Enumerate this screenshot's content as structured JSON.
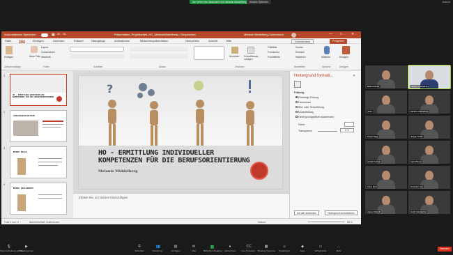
{
  "zoom": {
    "share_banner": "Sie sehen den Bildschirm von Melanie Middelberg",
    "view_options": "Ansicht Optionen",
    "top_right": "Ansicht",
    "toolbar": [
      {
        "icon": "microphone-icon",
        "label": "Stummschaltung aufheben"
      },
      {
        "icon": "camera-icon",
        "label": "Video beenden"
      },
      {
        "icon": "security-icon",
        "label": "Sicherheit"
      },
      {
        "icon": "participants-icon",
        "label": "Teilnehmer"
      },
      {
        "icon": "polls-icon",
        "label": "Umfragen"
      },
      {
        "icon": "chat-icon",
        "label": "Chat"
      },
      {
        "icon": "share-screen-icon",
        "label": "Bildschirm freigeben"
      },
      {
        "icon": "record-icon",
        "label": "Aufzeichnen"
      },
      {
        "icon": "transcript-icon",
        "label": "Live-Transkript"
      },
      {
        "icon": "breakout-icon",
        "label": "Breakout Sessions"
      },
      {
        "icon": "reactions-icon",
        "label": "Reaktionen"
      },
      {
        "icon": "apps-icon",
        "label": "Apps"
      },
      {
        "icon": "whiteboard-icon",
        "label": "Whiteboards"
      },
      {
        "icon": "more-icon",
        "label": "Mehr"
      }
    ],
    "end_button": "Beenden",
    "participants": [
      {
        "name": "Bettina Hofer"
      },
      {
        "name": "Melanie Middelberg"
      },
      {
        "name": "Josie"
      },
      {
        "name": "Melanie Middelberg"
      },
      {
        "name": "Kinga Nagy"
      },
      {
        "name": "Jürgen Nobis"
      },
      {
        "name": "Harald Jelinek"
      },
      {
        "name": "Ingrid Beyer"
      },
      {
        "name": "Anne Metz"
      },
      {
        "name": "Christian Lies"
      },
      {
        "name": "Agnes Meindl"
      },
      {
        "name": "Heidi Gaisbacher"
      }
    ]
  },
  "ppt": {
    "autosave": "Automatisches Speichern",
    "doc_title": "Präsentation_Projektarbeit_HO_MelanieMiddelberg • Gespeichert",
    "user": "Melanie Middelberg-Deltermann",
    "comments": "Kommentare",
    "share": "Freigeben",
    "tabs": [
      "Datei",
      "Start",
      "Einfügen",
      "Zeichnen",
      "Entwurf",
      "Übergänge",
      "Animationen",
      "Bildschirmpräsentation",
      "Überprüfen",
      "Ansicht",
      "Hilfe"
    ],
    "active_tab": "Start",
    "ribbon": {
      "paste": "Einfügen",
      "new_slide": "Neue Folie",
      "layout": "Layout",
      "reset": "Zurücksetzen",
      "section": "Abschnitt",
      "find": "Suchen",
      "replace": "Ersetzen",
      "select": "Markieren",
      "dictate": "Diktieren",
      "designer": "Designer",
      "arrange": "Anordnen",
      "quick_styles": "Schnellformat-vorlagen",
      "shape_fill": "Fülleffekt",
      "shape_outline": "Formkontur",
      "shape_effects": "Formeffekte",
      "groups": [
        "Zwischenablage",
        "Folien",
        "Schriftart",
        "Absatz",
        "Zeichnen",
        "Bearbeiten",
        "Sprache",
        "Designer"
      ]
    },
    "slides": [
      {
        "num": "1",
        "title": "HO - ERMITTLUNG INDIVIDUELLER KOMPETENZEN FÜR DIE BERUFSORIENTIERUNG"
      },
      {
        "num": "2",
        "title": "AUSGANGSSITUATION"
      },
      {
        "num": "3",
        "title": "MEINE ROLLE"
      },
      {
        "num": "4",
        "title": "MEINE ZIELGRUPPE"
      }
    ],
    "main_slide": {
      "title_line1": "HO - ERMITTLUNG INDIVIDUELLER",
      "title_line2": "KOMPETENZEN FÜR DIE BERUFSORIENTIERUNG",
      "subtitle": "Melanie Middelberg"
    },
    "notes_placeholder": "Klicken Sie, um Notizen hinzuzufügen",
    "format_pane": {
      "title": "Hintergrund formati...",
      "section": "Füllung",
      "options": [
        {
          "label": "Einfarbige Füllung",
          "selected": true
        },
        {
          "label": "Farbverlauf",
          "selected": false
        },
        {
          "label": "Bild- oder Texturfüllung",
          "selected": false
        },
        {
          "label": "Musterfüllung",
          "selected": false
        }
      ],
      "hide_graphics": "Hintergrundgrafiken ausblenden",
      "color_label": "Farbe",
      "transparency_label": "Transparenz",
      "transparency_value": "0 %",
      "apply_all": "Auf alle anwenden",
      "reset_bg": "Hintergrund zurücksetzen"
    },
    "status": {
      "slide_info": "Folie 1 von 17",
      "accessibility": "Barrierefreiheit: Untersuchen",
      "notes": "Notizen",
      "zoom": "68 %"
    }
  }
}
